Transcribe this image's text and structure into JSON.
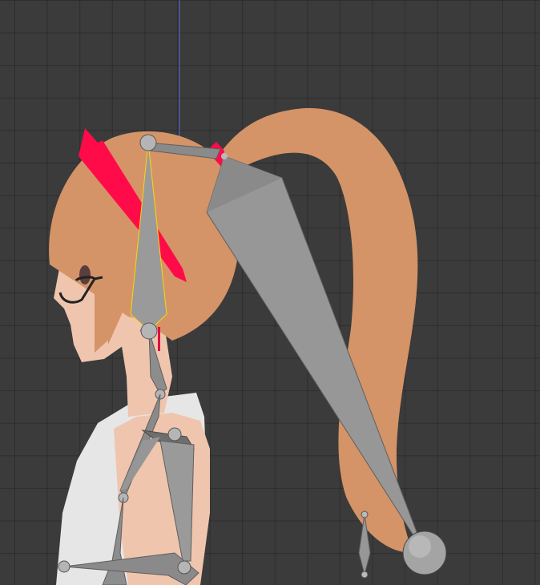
{
  "viewport": {
    "mode": "3d-viewport-side-view",
    "colors": {
      "background": "#3b3b3b",
      "hair": "#d49467",
      "skin": "#f0c5ae",
      "ribbon": "#ff0b4a",
      "shirt": "#e7e7e7",
      "bone": "#979797",
      "bone_dark": "#6e6e6e",
      "selected_outline": "#ffd700",
      "axis_line": "#4a6fd8"
    },
    "icons": [
      "head-bone-icon",
      "ponytail-bone-icon",
      "neck-bone-icon",
      "arm-bone-icon",
      "tail-bone-joint-icon"
    ]
  }
}
